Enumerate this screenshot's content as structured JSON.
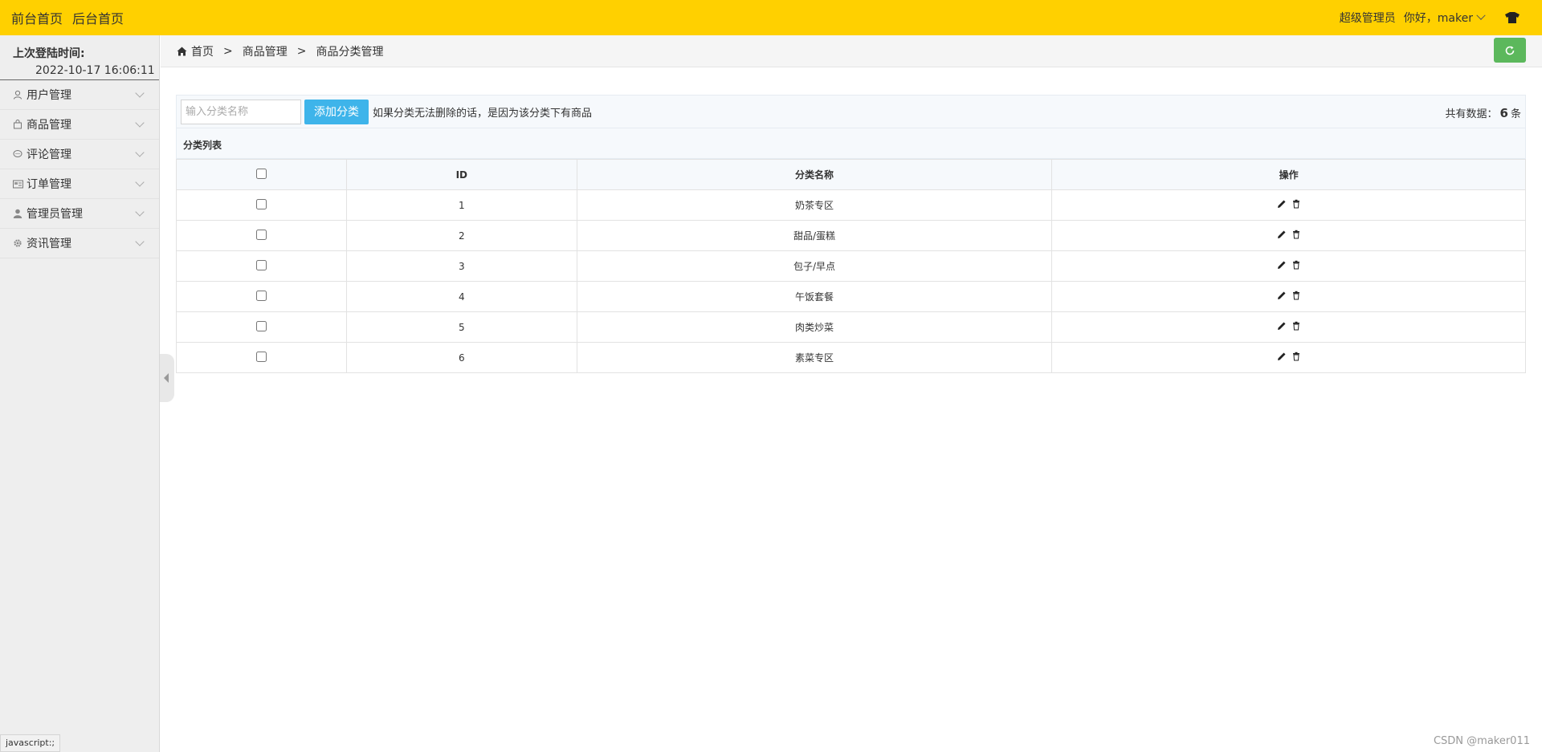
{
  "topbar": {
    "front_home": "前台首页",
    "back_home": "后台首页",
    "role": "超级管理员",
    "greeting": "你好，maker"
  },
  "sidebar": {
    "login_label": "上次登陆时间:",
    "login_time": "2022-10-17 16:06:11",
    "items": [
      {
        "label": "用户管理",
        "icon": "user-icon"
      },
      {
        "label": "商品管理",
        "icon": "bag-icon"
      },
      {
        "label": "评论管理",
        "icon": "comment-icon"
      },
      {
        "label": "订单管理",
        "icon": "order-icon"
      },
      {
        "label": "管理员管理",
        "icon": "admin-icon"
      },
      {
        "label": "资讯管理",
        "icon": "gear-icon"
      }
    ],
    "status_tip": "javascript:;"
  },
  "breadcrumb": {
    "home": "首页",
    "sep": ">",
    "level1": "商品管理",
    "level2": "商品分类管理"
  },
  "toolbar": {
    "input_placeholder": "输入分类名称",
    "add_label": "添加分类",
    "hint": "如果分类无法删除的话，是因为该分类下有商品",
    "total_prefix": "共有数据：",
    "total_count": "6",
    "total_suffix": "条"
  },
  "table": {
    "title": "分类列表",
    "headers": {
      "id": "ID",
      "name": "分类名称",
      "ops": "操作"
    },
    "rows": [
      {
        "id": "1",
        "name": "奶茶专区"
      },
      {
        "id": "2",
        "name": "甜品/蛋糕"
      },
      {
        "id": "3",
        "name": "包子/早点"
      },
      {
        "id": "4",
        "name": "午饭套餐"
      },
      {
        "id": "5",
        "name": "肉类炒菜"
      },
      {
        "id": "6",
        "name": "素菜专区"
      }
    ]
  },
  "watermark": "CSDN @maker011",
  "colors": {
    "topbar": "#ffd000",
    "add_button": "#3eb4ea",
    "refresh_button": "#5cb85c"
  }
}
